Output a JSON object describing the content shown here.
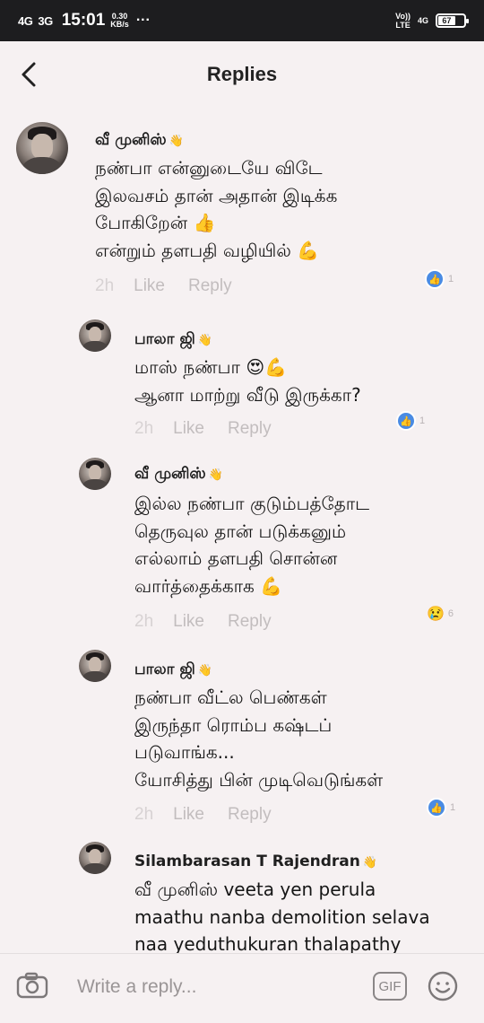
{
  "status_bar": {
    "signal_1": "4G",
    "signal_2": "3G",
    "time": "15:01",
    "speed_value": "0.30",
    "speed_unit": "KB/s",
    "dots": "···",
    "volte_1": "Vo))",
    "volte_2": "LTE",
    "network": "4G",
    "battery": "67"
  },
  "header": {
    "title": "Replies"
  },
  "comments": [
    {
      "name": "வீ முனிஸ்",
      "text": "நண்பா என்னுடையே விடே\nஇலவசம் தான் அதான் இடிக்க\nபோகிறேன் 👍\nஎன்றும் தளபதி வழியில் 💪",
      "time": "2h",
      "like": "Like",
      "reply": "Reply",
      "reaction_count": "1"
    },
    {
      "name": "பாலா ஜி",
      "text": "மாஸ் நண்பா 😍💪\nஆனா மாற்று வீடு இருக்கா?",
      "time": "2h",
      "like": "Like",
      "reply": "Reply",
      "reaction_count": "1"
    },
    {
      "name": "வீ முனிஸ்",
      "text": "இல்ல நண்பா குடும்பத்தோட\nதெருவுல தான் படுக்கனும்\nஎல்லாம் தளபதி சொன்ன\nவார்த்தைக்காக 💪",
      "time": "2h",
      "like": "Like",
      "reply": "Reply",
      "reaction_count": "6"
    },
    {
      "name": "பாலா ஜி",
      "text": "நண்பா வீட்ல பெண்கள்\nஇருந்தா ரொம்ப கஷ்டப்\nபடுவாங்க...\nயோசித்து பின் முடிவெடுங்கள்",
      "time": "2h",
      "like": "Like",
      "reply": "Reply",
      "reaction_count": "1"
    },
    {
      "name": "Silambarasan T Rajendran",
      "text": "வீ முனிஸ் veeta yen perula\nmaathu nanba demolition selava\nnaa yeduthukuran thalapathy"
    }
  ],
  "wave_icon": "👋",
  "composer": {
    "placeholder": "Write a reply...",
    "gif_label": "GIF"
  },
  "colors": {
    "background": "#f6f1f2",
    "status_bar": "#1d1d1f",
    "like_badge": "#4a8be3",
    "meta_text": "#c2bdbe"
  }
}
